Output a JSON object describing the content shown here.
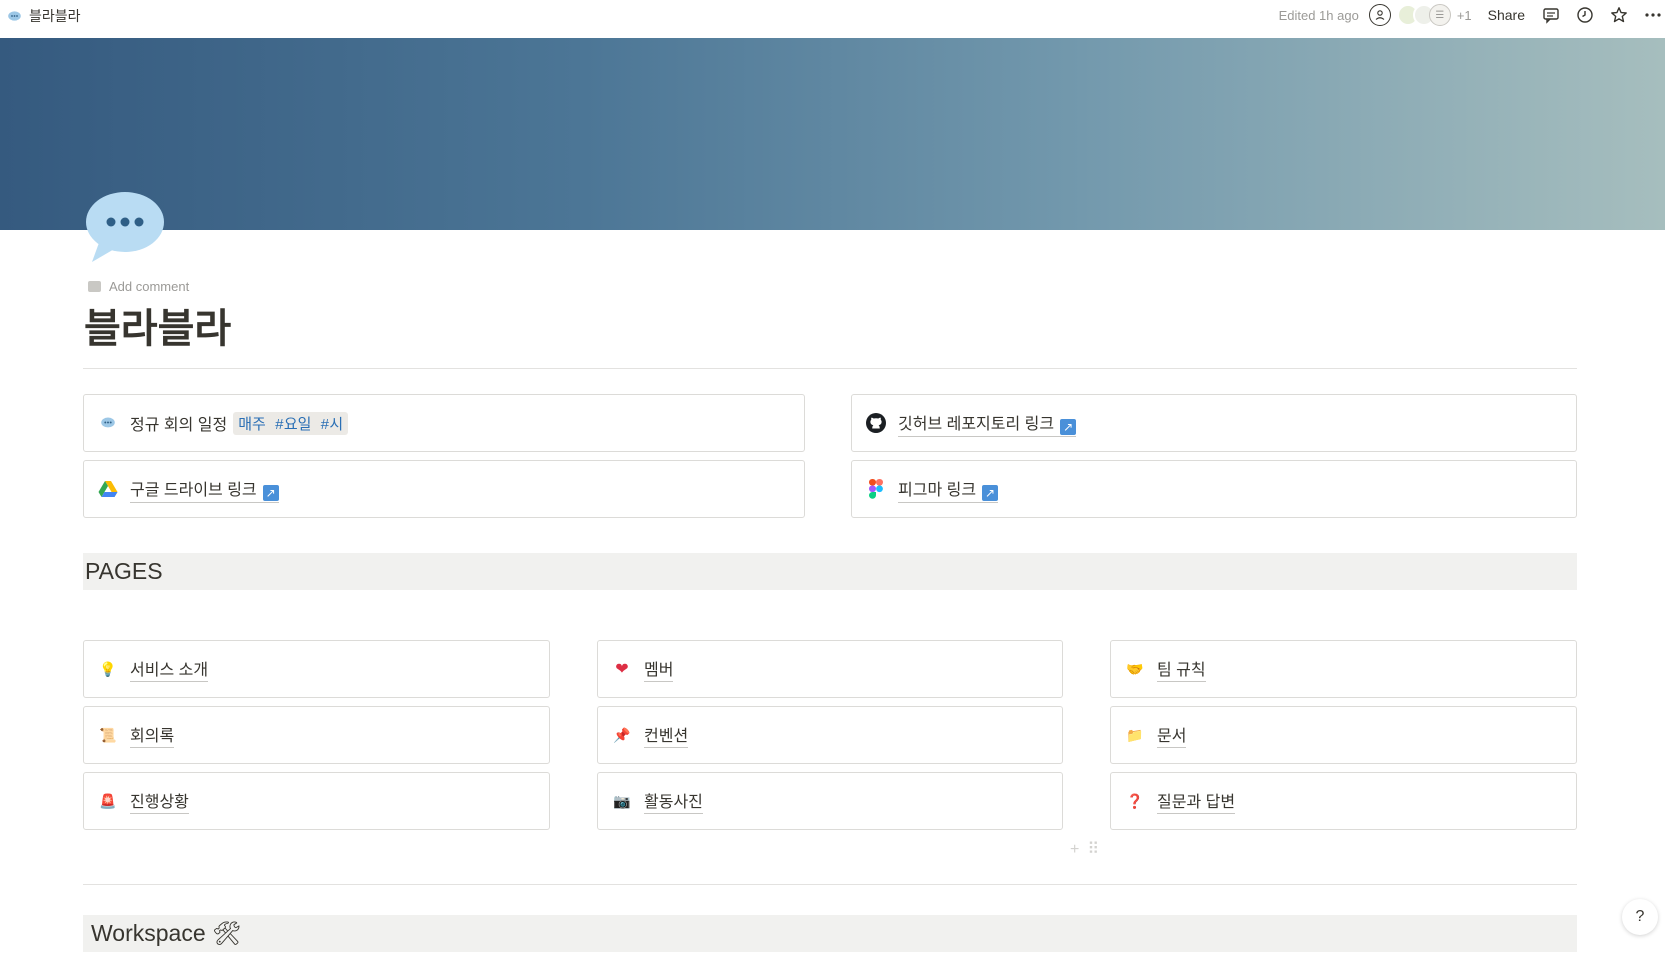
{
  "breadcrumb": {
    "title": "블라블라"
  },
  "topbar": {
    "edited": "Edited 1h ago",
    "extra_count": "+1",
    "share": "Share"
  },
  "page": {
    "add_comment": "Add comment",
    "title": "블라블라"
  },
  "top_cards": [
    {
      "icon": "speech-bubble-icon",
      "label": "정규 회의 일정",
      "code": "매주 #요일 #시"
    },
    {
      "icon": "github-icon",
      "label": "깃허브 레포지토리 링크"
    },
    {
      "icon": "google-drive-icon",
      "label": "구글 드라이브 링크"
    },
    {
      "icon": "figma-icon",
      "label": "피그마 링크"
    }
  ],
  "pages_section": {
    "heading": "PAGES"
  },
  "pages": [
    {
      "icon": "lightbulb-icon",
      "emoji": "💡",
      "label": "서비스 소개"
    },
    {
      "icon": "heart-icon",
      "emoji": "❤",
      "label": "멤버"
    },
    {
      "icon": "handshake-icon",
      "emoji": "🤝",
      "label": "팀 규칙"
    },
    {
      "icon": "scroll-icon",
      "emoji": "📜",
      "label": "회의록"
    },
    {
      "icon": "pushpin-icon",
      "emoji": "📌",
      "label": "컨벤션"
    },
    {
      "icon": "folder-icon",
      "emoji": "📁",
      "label": "문서"
    },
    {
      "icon": "siren-icon",
      "emoji": "🚨",
      "label": "진행상황"
    },
    {
      "icon": "camera-icon",
      "emoji": "📷",
      "label": "활동사진"
    },
    {
      "icon": "question-mark-icon",
      "emoji": "❓",
      "label": "질문과 답변"
    }
  ],
  "workspace_section": {
    "heading": "Workspace 🛠"
  },
  "help": {
    "label": "?"
  }
}
